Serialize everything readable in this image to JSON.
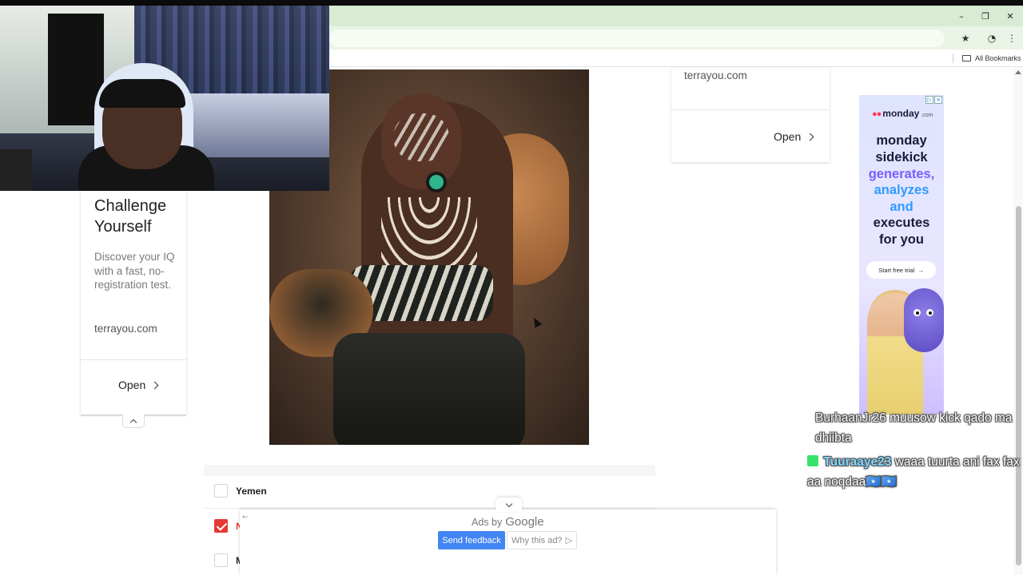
{
  "browser": {
    "window_controls": {
      "minimize": "–",
      "restore": "❐",
      "close": "✕"
    },
    "bookmarks_bar": {
      "all_bookmarks": "All Bookmarks"
    }
  },
  "left_ad_card": {
    "title": "Challenge Yourself",
    "description": "Discover your IQ with a fast, no-registration test.",
    "domain": "terrayou.com",
    "open_label": "Open"
  },
  "right_ad_card": {
    "domain": "terrayou.com",
    "open_label": "Open"
  },
  "monday_ad": {
    "brand": "monday",
    "brand_suffix": ".com",
    "lines": [
      {
        "text": "monday",
        "color": "#1b1b3a"
      },
      {
        "text": "sidekick",
        "color": "#1b1b3a"
      },
      {
        "text": "generates,",
        "color": "#7b5cff"
      },
      {
        "text": "analyzes",
        "color": "#2e9bff"
      },
      {
        "text": "and",
        "color": "#2e9bff"
      },
      {
        "text": "executes",
        "color": "#1b1b3a"
      },
      {
        "text": "for you",
        "color": "#1b1b3a"
      }
    ],
    "cta": "Start free trial"
  },
  "poll": {
    "options": [
      {
        "label": "Yemen",
        "checked": false
      },
      {
        "label": "N",
        "checked": true
      },
      {
        "label": "M",
        "checked": false
      }
    ]
  },
  "anchor_ad": {
    "ads_by": "Ads by",
    "google": "Google",
    "send_feedback": "Send feedback",
    "why_this_ad": "Why this ad?"
  },
  "chat": [
    {
      "user": "BurhaanJr26",
      "message": "muusow kick qado ma dhiibta"
    },
    {
      "user": "Tuuraaye23",
      "message": "waaa tuurta ani fax fax aa noqdaa🇸🇴🇸🇴"
    }
  ],
  "colors": {
    "accent_red": "#e53935",
    "google_blue": "#4285f4",
    "chrome_green": "#d7ecd3"
  }
}
